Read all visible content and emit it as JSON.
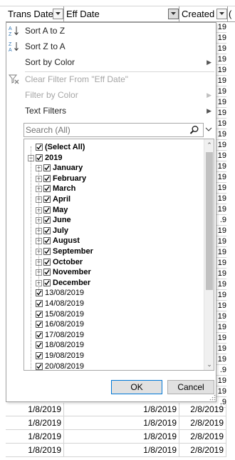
{
  "sheet": {
    "headers": [
      {
        "label": "Trans Date"
      },
      {
        "label": "Eff Date"
      },
      {
        "label": "Created"
      }
    ],
    "partial_right_values": [
      "19",
      "19",
      "19",
      "19",
      "19",
      "19",
      "19",
      "19",
      "19",
      "19",
      "19",
      "19",
      "19",
      "19",
      "19",
      "19",
      "19",
      "19",
      ".9",
      "19",
      "19",
      "19",
      "19",
      "19",
      "19",
      "19",
      "19",
      "19",
      "19",
      "19",
      "19",
      "19",
      ".9",
      "19",
      "19",
      ".9"
    ],
    "rows": [
      {
        "trans_date": "1/8/2019",
        "eff_date": "1/8/2019",
        "created": "2/8/2019"
      },
      {
        "trans_date": "1/8/2019",
        "eff_date": "1/8/2019",
        "created": "2/8/2019"
      },
      {
        "trans_date": "1/8/2019",
        "eff_date": "1/8/2019",
        "created": "2/8/2019"
      },
      {
        "trans_date": "1/8/2019",
        "eff_date": "1/8/2019",
        "created": "2/8/2019"
      }
    ]
  },
  "menu": {
    "sort_az": "Sort A to Z",
    "sort_za": "Sort Z to A",
    "sort_color": "Sort by Color",
    "clear_filter": "Clear Filter From \"Eff Date\"",
    "filter_color": "Filter by Color",
    "text_filters": "Text Filters",
    "search_placeholder": "Search (All)",
    "tree": {
      "select_all": "(Select All)",
      "year": "2019",
      "months": [
        "January",
        "February",
        "March",
        "April",
        "May",
        "June",
        "July",
        "August",
        "September",
        "October",
        "November",
        "December"
      ],
      "dates": [
        "13/08/2019",
        "14/08/2019",
        "15/08/2019",
        "16/08/2019",
        "17/08/2019",
        "18/08/2019",
        "19/08/2019",
        "20/08/2019"
      ]
    },
    "ok_label": "OK",
    "cancel_label": "Cancel"
  },
  "colors": {
    "accent": "#0078d7",
    "disabled_text": "#a6a6a6",
    "sort_blue": "#2e75b6",
    "clear_icon": "#7f7f7f"
  }
}
